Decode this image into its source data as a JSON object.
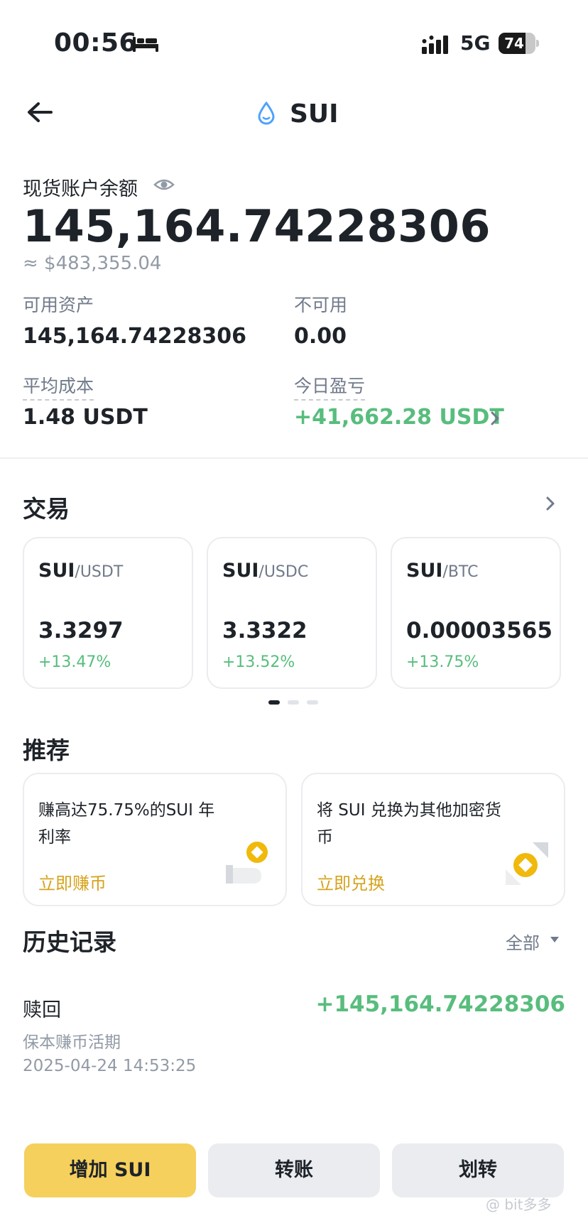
{
  "status_bar": {
    "time": "00:56",
    "network": "5G",
    "battery": "74",
    "battery_level": 0.74
  },
  "header": {
    "title": "SUI"
  },
  "balance": {
    "label": "现货账户余额",
    "value": "145,164.74228306",
    "usd": "≈ $483,355.04"
  },
  "stats": {
    "available_label": "可用资产",
    "available_value": "145,164.74228306",
    "unavailable_label": "不可用",
    "unavailable_value": "0.00",
    "avg_cost_label": "平均成本",
    "avg_cost_value": "1.48 USDT",
    "today_pnl_label": "今日盈亏",
    "today_pnl_value": "+41,662.28 USDT"
  },
  "trade": {
    "title": "交易",
    "pairs": [
      {
        "base": "SUI",
        "quote": "/USDT",
        "price": "3.3297",
        "change": "+13.47%"
      },
      {
        "base": "SUI",
        "quote": "/USDC",
        "price": "3.3322",
        "change": "+13.52%"
      },
      {
        "base": "SUI",
        "quote": "/BTC",
        "price": "0.00003565",
        "change": "+13.75%"
      }
    ],
    "pager": {
      "total": 3,
      "active": 1
    }
  },
  "recommend": {
    "title": "推荐",
    "cards": [
      {
        "text": "赚高达75.75%的SUI 年利率",
        "link": "立即赚币"
      },
      {
        "text": "将 SUI 兑换为其他加密货币",
        "link": "立即兑换"
      }
    ]
  },
  "history": {
    "title": "历史记录",
    "filter": "全部",
    "items": [
      {
        "type": "赎回",
        "subtitle": "保本赚币活期",
        "time": "2025-04-24 14:53:25",
        "amount": "+145,164.74228306"
      }
    ]
  },
  "actions": {
    "deposit": "增加 SUI",
    "transfer": "转账",
    "internal_transfer": "划转"
  },
  "watermark": "@ bit多多",
  "colors": {
    "up": "#58bd7d",
    "accent": "#f5d05c",
    "link": "#d6a31d"
  }
}
